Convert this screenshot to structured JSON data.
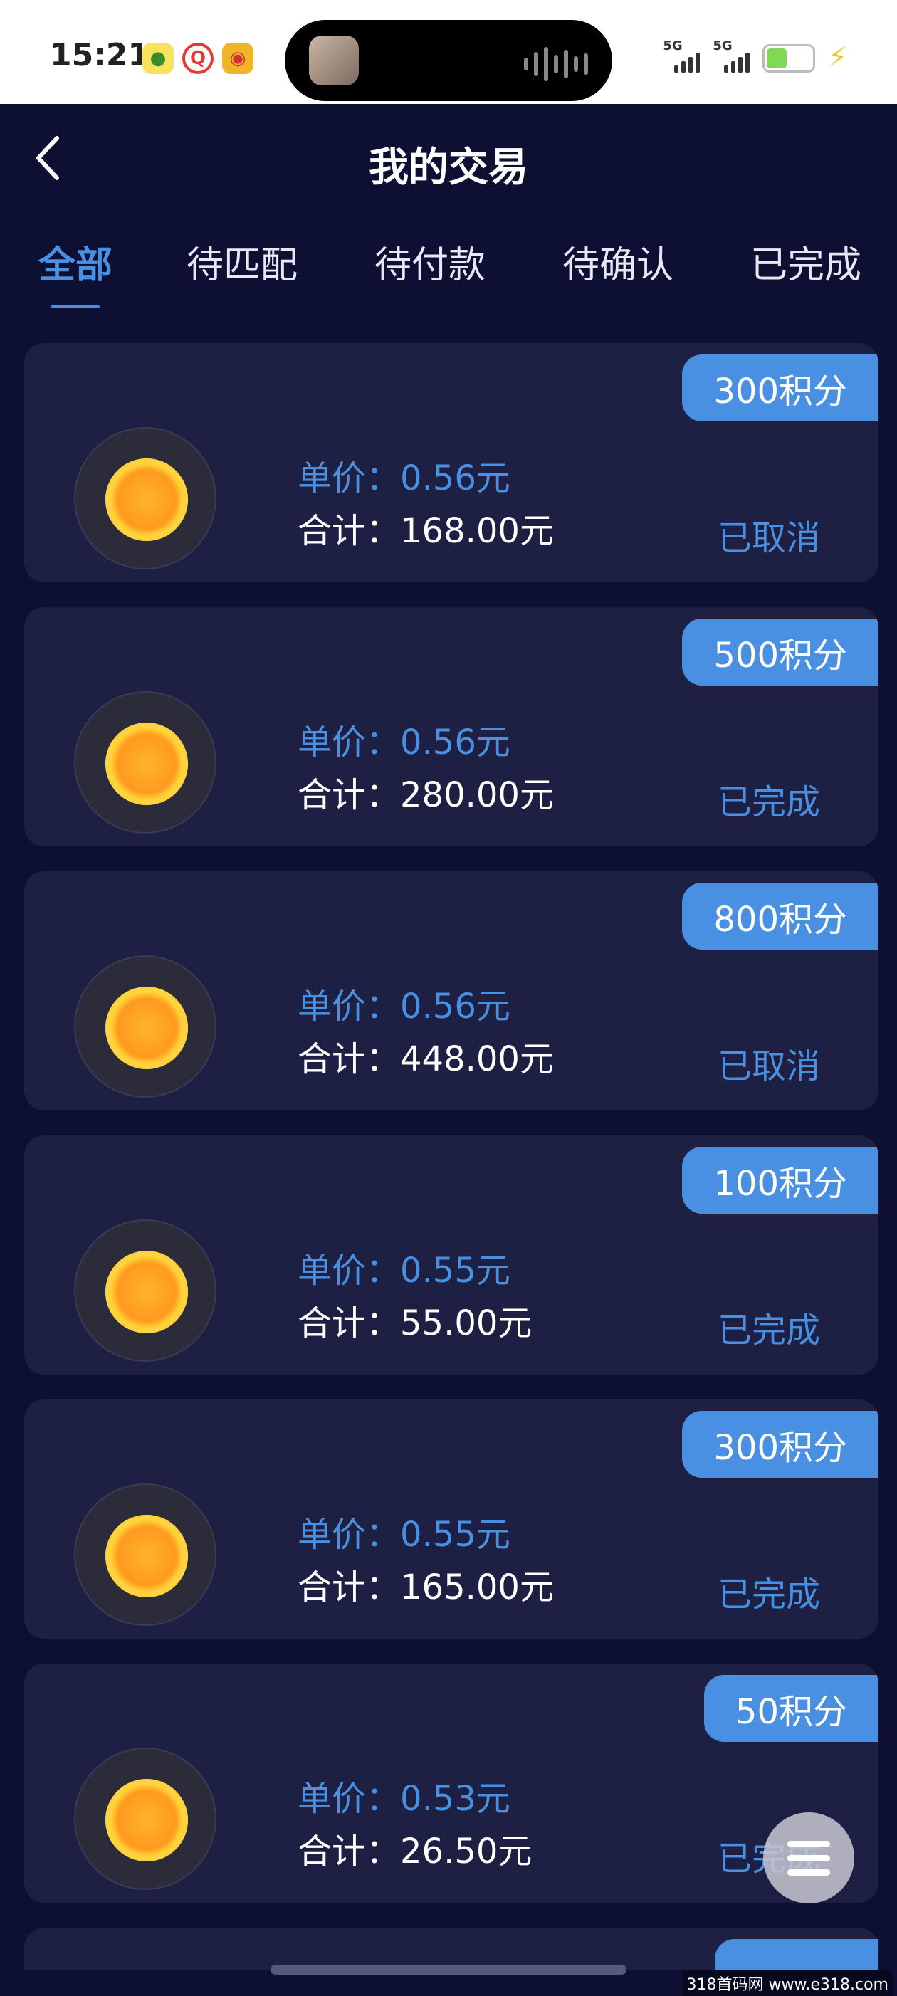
{
  "status_bar": {
    "time": "15:21",
    "signal_label_1": "5G",
    "signal_label_2": "5G"
  },
  "header": {
    "title": "我的交易"
  },
  "tabs": [
    {
      "label": "全部",
      "active": true
    },
    {
      "label": "待匹配",
      "active": false
    },
    {
      "label": "待付款",
      "active": false
    },
    {
      "label": "待确认",
      "active": false
    },
    {
      "label": "已完成",
      "active": false
    }
  ],
  "orders": [
    {
      "points": "300积分",
      "unit_price": "单价：0.56元",
      "total": "合计：168.00元",
      "status": "已取消"
    },
    {
      "points": "500积分",
      "unit_price": "单价：0.56元",
      "total": "合计：280.00元",
      "status": "已完成"
    },
    {
      "points": "800积分",
      "unit_price": "单价：0.56元",
      "total": "合计：448.00元",
      "status": "已取消"
    },
    {
      "points": "100积分",
      "unit_price": "单价：0.55元",
      "total": "合计：55.00元",
      "status": "已完成"
    },
    {
      "points": "300积分",
      "unit_price": "单价：0.55元",
      "total": "合计：165.00元",
      "status": "已完成"
    },
    {
      "points": "50积分",
      "unit_price": "单价：0.53元",
      "total": "合计：26.50元",
      "status": "已完成"
    }
  ],
  "watermark": "318首码网 www.e318.com",
  "colors": {
    "accent": "#4a90e2",
    "background": "#0d0f33",
    "card": "#1d2042"
  }
}
